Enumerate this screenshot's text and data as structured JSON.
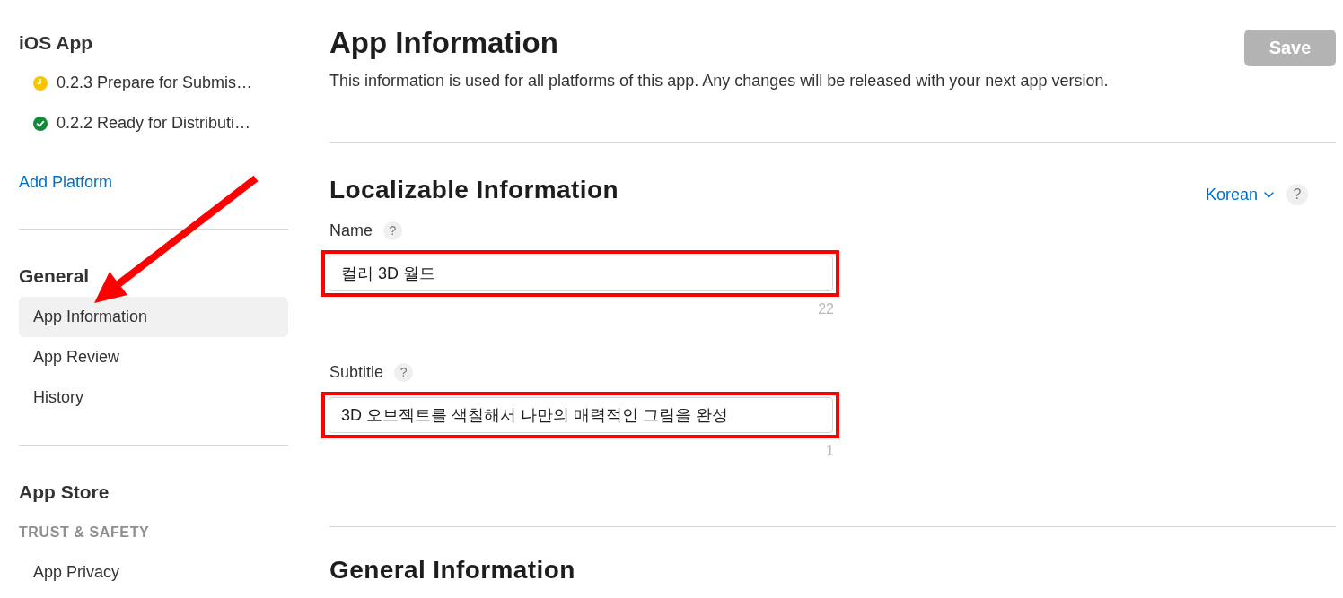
{
  "sidebar": {
    "platform": {
      "title": "iOS App",
      "versions": [
        {
          "label": "0.2.3 Prepare for Submis…",
          "kind": "pending"
        },
        {
          "label": "0.2.2 Ready for Distributi…",
          "kind": "ready"
        }
      ]
    },
    "add_platform": "Add Platform",
    "general": {
      "title": "General",
      "items": [
        {
          "label": "App Information",
          "selected": true
        },
        {
          "label": "App Review",
          "selected": false
        },
        {
          "label": "History",
          "selected": false
        }
      ]
    },
    "app_store": {
      "title": "App Store",
      "groups": [
        {
          "heading": "TRUST & SAFETY",
          "items": [
            {
              "label": "App Privacy",
              "selected": false
            }
          ]
        }
      ]
    }
  },
  "main": {
    "title": "App Information",
    "description": "This information is used for all platforms of this app. Any changes will be released with your next app version.",
    "save_button": {
      "label": "Save",
      "disabled": true
    },
    "localizable": {
      "title": "Localizable Information",
      "language": "Korean",
      "help": "?",
      "fields": [
        {
          "label": "Name",
          "help": "?",
          "value": "컬러 3D 월드",
          "count": "22",
          "highlighted": true
        },
        {
          "label": "Subtitle",
          "help": "?",
          "value": "3D 오브젝트를 색칠해서 나만의 매력적인 그림을 완성",
          "count": "1",
          "highlighted": true
        }
      ]
    },
    "general": {
      "title": "General Information"
    }
  }
}
